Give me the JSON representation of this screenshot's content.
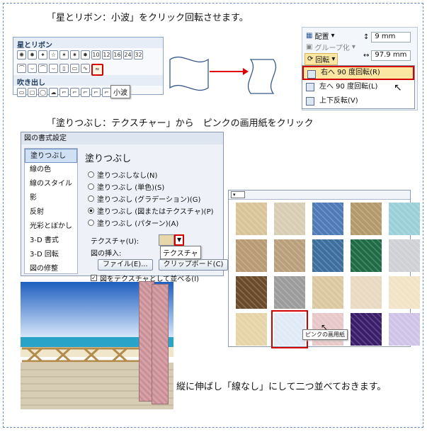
{
  "captions": {
    "top": "「星とリボン：小波」をクリック回転させます。",
    "middle": "「塗りつぶし：テクスチャー」から　ピンクの画用紙をクリック",
    "bottom": "縦に伸ばし「線なし」にして二つ並べておきます。"
  },
  "shape_panel": {
    "section1": "星とリボン",
    "section2": "吹き出し",
    "tooltip": "小波",
    "row1_nums": [
      "10",
      "12",
      "16",
      "24",
      "32"
    ]
  },
  "ribbon": {
    "align_label": "配置",
    "group_label": "グループ化",
    "rotate_label": "回転",
    "height_value": "9 mm",
    "width_value": "97.9 mm"
  },
  "rotate_menu": {
    "items": [
      "右へ 90 度回転(R)",
      "左へ 90 度回転(L)",
      "上下反転(V)"
    ]
  },
  "dialog": {
    "title": "図の書式設定",
    "side_items": [
      "塗りつぶし",
      "線の色",
      "線のスタイル",
      "影",
      "反射",
      "光彩とぼかし",
      "3-D 書式",
      "3-D 回転",
      "図の修整"
    ],
    "heading": "塗りつぶし",
    "options": [
      "塗りつぶしなし(N)",
      "塗りつぶし (単色)(S)",
      "塗りつぶし (グラデーション)(G)",
      "塗りつぶし (図またはテクスチャ)(P)",
      "塗りつぶし (パターン)(A)"
    ],
    "texture_label": "テクスチャ(U):",
    "texture_tooltip": "テクスチャ",
    "insert_label": "図の挿入:",
    "file_button": "ファイル(E)...",
    "clipboard_button": "クリップボード(C)",
    "tile_checkbox": "図をテクスチャとして並べる(I)"
  },
  "gallery": {
    "tooltip": "ピンクの画用紙",
    "selected_index": 16,
    "tiles": [
      "#d9c49a",
      "#d8cdb3",
      "#4f7ab8",
      "#b49a6a",
      "#9ad0d8",
      "#b89a74",
      "#b9a07a",
      "#3c6e9e",
      "#1f6b45",
      "#cfd1d4",
      "#6b4a2a",
      "#9c9c9c",
      "#dcc8a0",
      "#e8d9c0",
      "#f1e4c6",
      "#e6d3a8",
      "#e0eaf6",
      "#e8c7c8",
      "#3a1d6b",
      "#cfc4e8"
    ]
  }
}
